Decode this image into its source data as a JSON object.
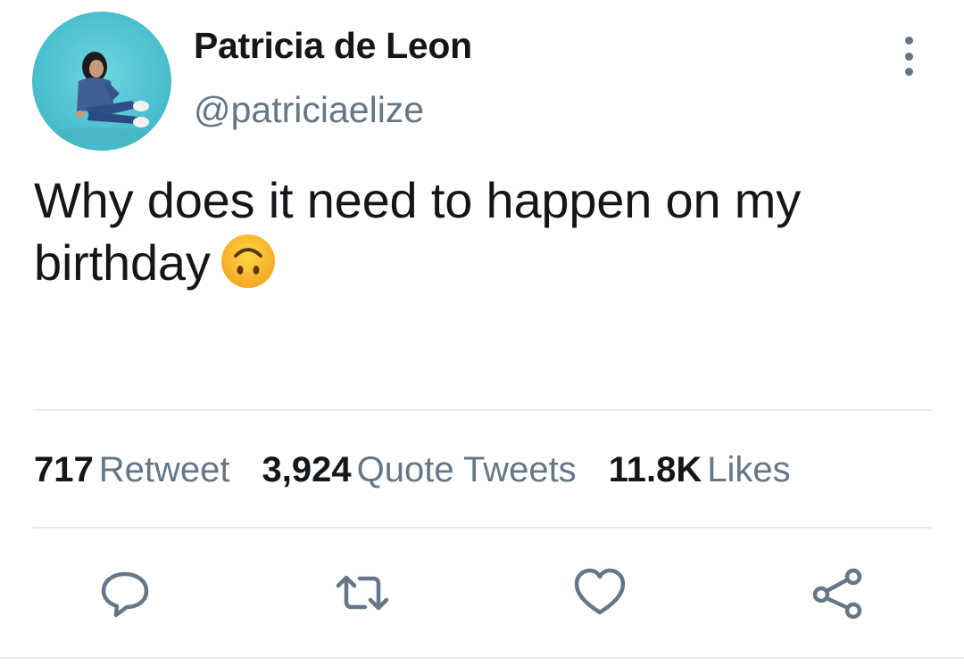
{
  "tweet": {
    "display_name": "Patricia de Leon",
    "handle": "@patriciaelize",
    "text": "Why does it need to happen on my birthday",
    "emoji": "upside-down-face-emoji"
  },
  "stats": {
    "retweets": {
      "value": "717",
      "label": "Retweet"
    },
    "quotes": {
      "value": "3,924",
      "label": "Quote Tweets"
    },
    "likes": {
      "value": "11.8K",
      "label": "Likes"
    }
  },
  "icons": {
    "more": "more-options-icon",
    "reply": "reply-icon",
    "retweet": "retweet-icon",
    "like": "heart-icon",
    "share": "share-icon"
  },
  "colors": {
    "text": "#14171a",
    "secondary": "#657786",
    "divider": "#e6ecf0",
    "avatar_bg": "#56c8d6"
  }
}
